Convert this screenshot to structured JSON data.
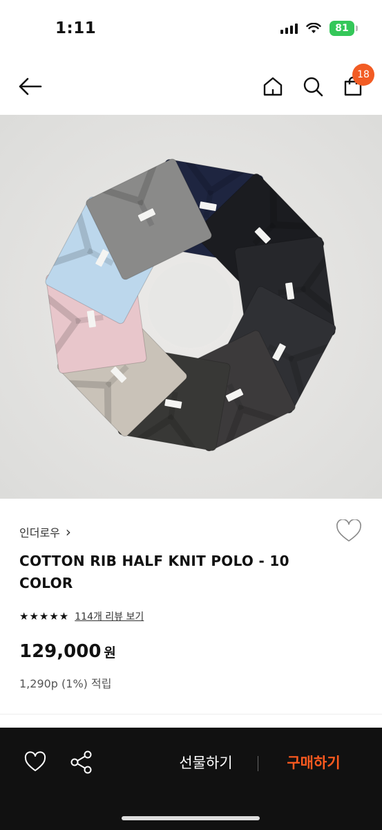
{
  "status_bar": {
    "time": "1:11",
    "battery": "81"
  },
  "header": {
    "cart_count": "18"
  },
  "product": {
    "brand": "인더로우",
    "brand_chevron": "›",
    "name": "COTTON RIB HALF KNIT POLO - 10 COLOR",
    "stars": "★★★★★",
    "rating": 5,
    "review_link": "114개 리뷰 보기",
    "price": "129,000",
    "price_unit": "원",
    "points": "1,290p (1%) 적립"
  },
  "bottom_bar": {
    "gift_label": "선물하기",
    "buy_label": "구매하기"
  },
  "colors": {
    "accent": "#f25c24",
    "buy_text": "#ff5a1f",
    "bottom_bar_bg": "#111111",
    "image_bg": "#e7e7e5",
    "shirts": [
      "#1e2540",
      "#1b1c20",
      "#26272b",
      "#2f3034",
      "#3c3a3b",
      "#383836",
      "#c9c2b8",
      "#e8c6cb",
      "#bcd7ec",
      "#8a8a89"
    ]
  },
  "icons": [
    "back-arrow-icon",
    "home-icon",
    "search-icon",
    "cart-icon",
    "heart-icon",
    "share-icon",
    "star-icon",
    "chevron-right-icon"
  ]
}
